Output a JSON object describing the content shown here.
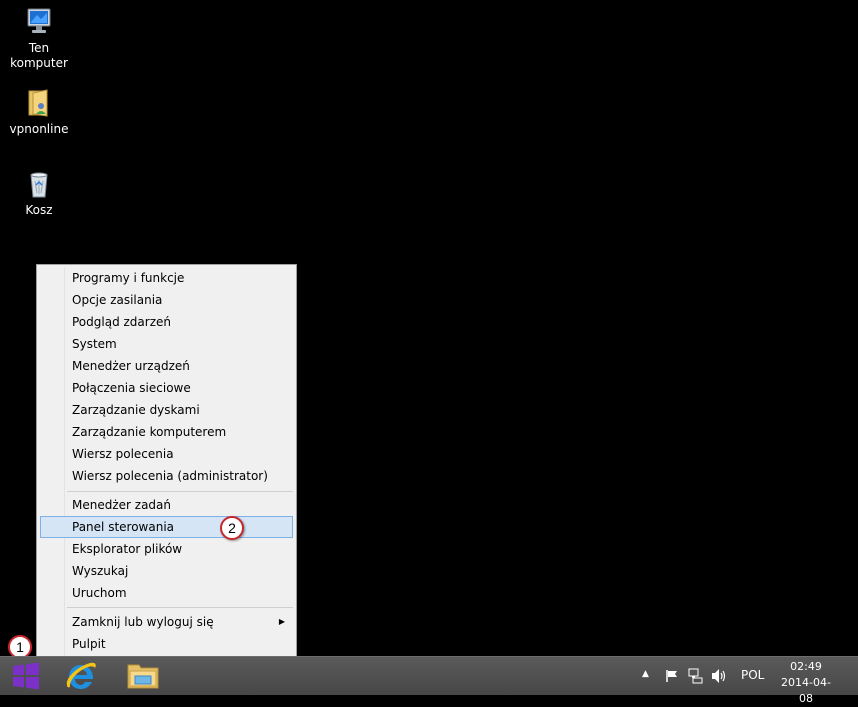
{
  "desktop": {
    "icons": [
      {
        "label_line1": "Ten",
        "label_line2": "komputer",
        "icon": "computer-icon"
      },
      {
        "label_line1": "vpnonline",
        "label_line2": "",
        "icon": "folder-user-icon"
      },
      {
        "label_line1": "Kosz",
        "label_line2": "",
        "icon": "recycle-bin-icon"
      }
    ]
  },
  "context_menu": {
    "group1": [
      "Programy i funkcje",
      "Opcje zasilania",
      "Podgląd zdarzeń",
      "System",
      "Menedżer urządzeń",
      "Połączenia sieciowe",
      "Zarządzanie dyskami",
      "Zarządzanie komputerem",
      "Wiersz polecenia",
      "Wiersz polecenia (administrator)"
    ],
    "group2": [
      "Menedżer zadań",
      "Panel sterowania",
      "Eksplorator plików",
      "Wyszukaj",
      "Uruchom"
    ],
    "group3": [
      "Zamknij lub wyloguj się",
      "Pulpit"
    ],
    "highlighted": "Panel sterowania",
    "submenu_arrow": "▶"
  },
  "callouts": {
    "one": "1",
    "two": "2"
  },
  "taskbar": {
    "pinned": [
      "start-icon",
      "internet-explorer-icon",
      "file-explorer-icon"
    ],
    "tray": {
      "language": "POL",
      "time": "02:49",
      "date": "2014-04-08",
      "show_hidden": "▲"
    }
  },
  "colors": {
    "desktop_bg": "#000000",
    "start_tile": "#7b30c8",
    "ie_blue": "#1f8fe0",
    "highlight": "#d5e5f6",
    "badge_border": "#c8262a"
  }
}
